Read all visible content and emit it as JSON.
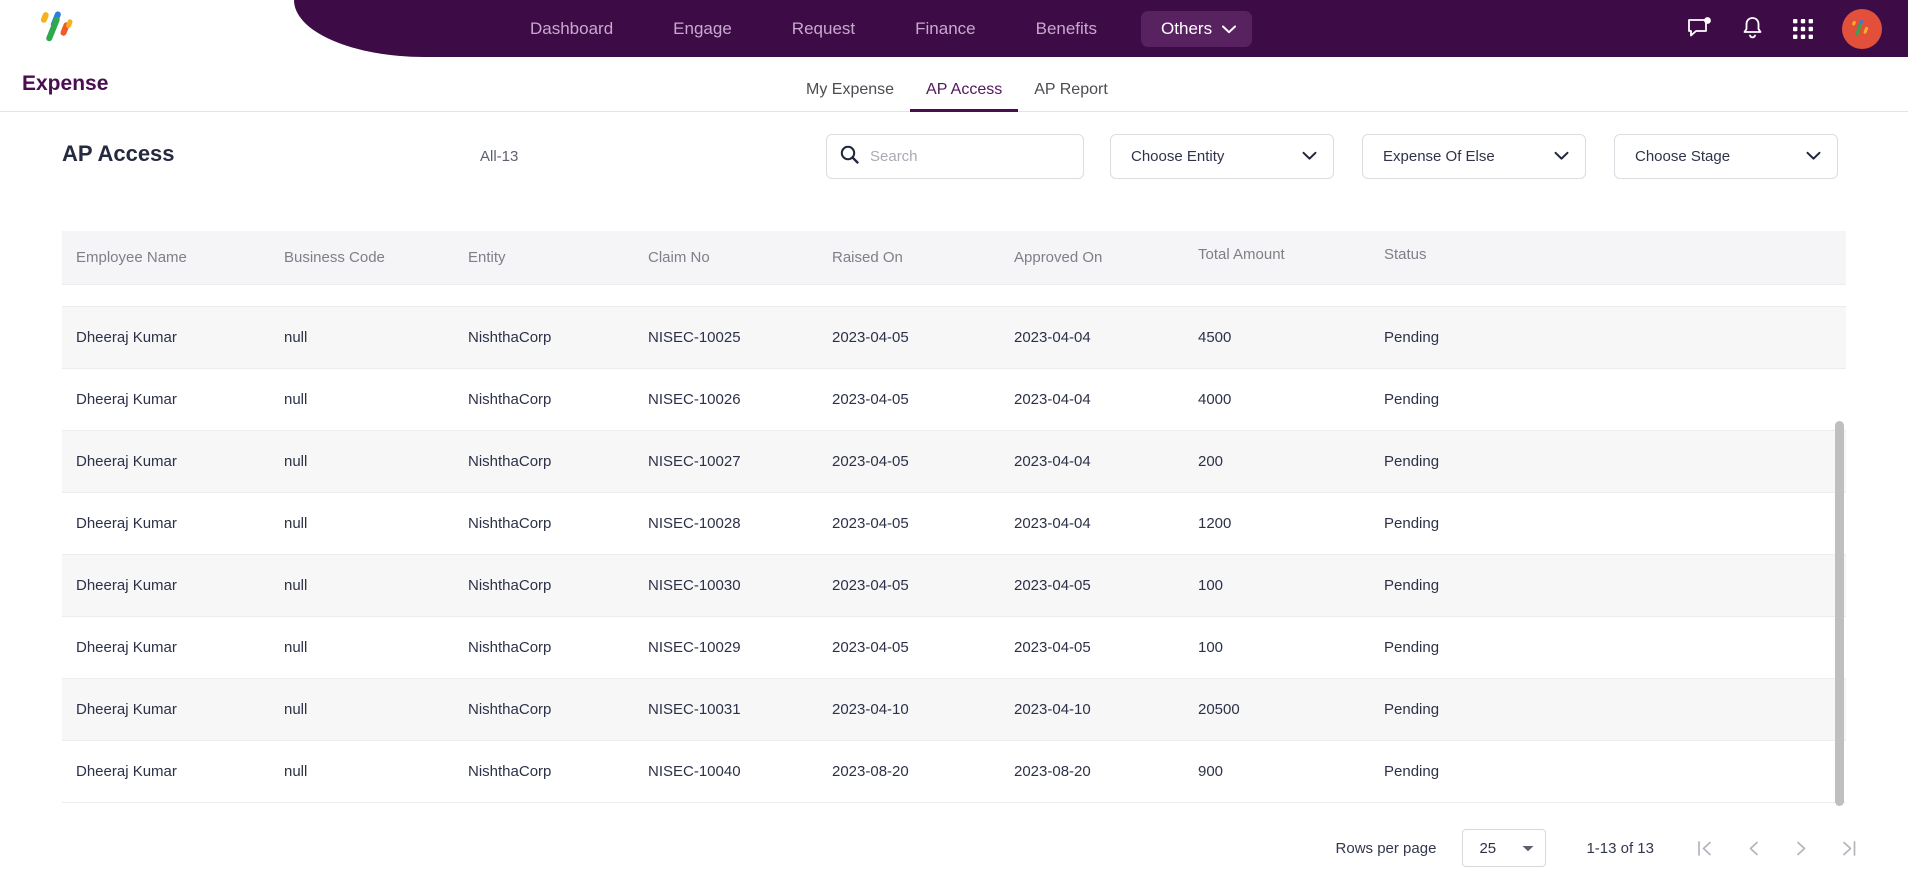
{
  "topnav": {
    "logo_icon": "brand-percent-logo",
    "links": [
      {
        "label": "Dashboard",
        "name": "nav-link-dashboard"
      },
      {
        "label": "Engage",
        "name": "nav-link-engage"
      },
      {
        "label": "Request",
        "name": "nav-link-request"
      },
      {
        "label": "Finance",
        "name": "nav-link-finance"
      },
      {
        "label": "Benefits",
        "name": "nav-link-benefits"
      }
    ],
    "others_label": "Others",
    "icons": [
      "chat-icon",
      "bell-icon",
      "apps-grid-icon",
      "avatar"
    ],
    "colors": {
      "bar": "#3d0b45",
      "pill": "#58215f",
      "link": "#c9a8cf",
      "avatar_bg": "#e2503c"
    }
  },
  "subheader": {
    "app_title": "Expense",
    "tabs": [
      {
        "label": "My Expense",
        "active": false
      },
      {
        "label": "AP Access",
        "active": true
      },
      {
        "label": "AP Report",
        "active": false
      }
    ],
    "active_color": "#4a0d52"
  },
  "filterbar": {
    "page_title": "AP Access",
    "all_count": "All-13",
    "search": {
      "value": "",
      "placeholder": "Search",
      "icon": "search-icon"
    },
    "dropdowns": [
      {
        "label": "Choose Entity",
        "name": "choose-entity-dropdown"
      },
      {
        "label": "Expense Of Else",
        "name": "expense-of-else-dropdown"
      },
      {
        "label": "Choose Stage",
        "name": "choose-stage-dropdown"
      }
    ]
  },
  "table": {
    "columns": [
      "Employee Name",
      "Business Code",
      "Entity",
      "Claim No",
      "Raised On",
      "Approved On",
      "Total Amount",
      "Status"
    ],
    "rows": [
      [
        "Dheeraj Kumar",
        "null",
        "NishthaCorp",
        "NISEC-10025",
        "2023-04-05",
        "2023-04-04",
        "4500",
        "Pending"
      ],
      [
        "Dheeraj Kumar",
        "null",
        "NishthaCorp",
        "NISEC-10026",
        "2023-04-05",
        "2023-04-04",
        "4000",
        "Pending"
      ],
      [
        "Dheeraj Kumar",
        "null",
        "NishthaCorp",
        "NISEC-10027",
        "2023-04-05",
        "2023-04-04",
        "200",
        "Pending"
      ],
      [
        "Dheeraj Kumar",
        "null",
        "NishthaCorp",
        "NISEC-10028",
        "2023-04-05",
        "2023-04-04",
        "1200",
        "Pending"
      ],
      [
        "Dheeraj Kumar",
        "null",
        "NishthaCorp",
        "NISEC-10030",
        "2023-04-05",
        "2023-04-05",
        "100",
        "Pending"
      ],
      [
        "Dheeraj Kumar",
        "null",
        "NishthaCorp",
        "NISEC-10029",
        "2023-04-05",
        "2023-04-05",
        "100",
        "Pending"
      ],
      [
        "Dheeraj Kumar",
        "null",
        "NishthaCorp",
        "NISEC-10031",
        "2023-04-10",
        "2023-04-10",
        "20500",
        "Pending"
      ],
      [
        "Dheeraj Kumar",
        "null",
        "NishthaCorp",
        "NISEC-10040",
        "2023-08-20",
        "2023-08-20",
        "900",
        "Pending"
      ]
    ]
  },
  "pagination": {
    "rows_per_page_label": "Rows per page",
    "rows_per_page_value": "25",
    "range_label": "1-13 of 13",
    "buttons": [
      "first-page",
      "previous-page",
      "next-page",
      "last-page"
    ]
  }
}
